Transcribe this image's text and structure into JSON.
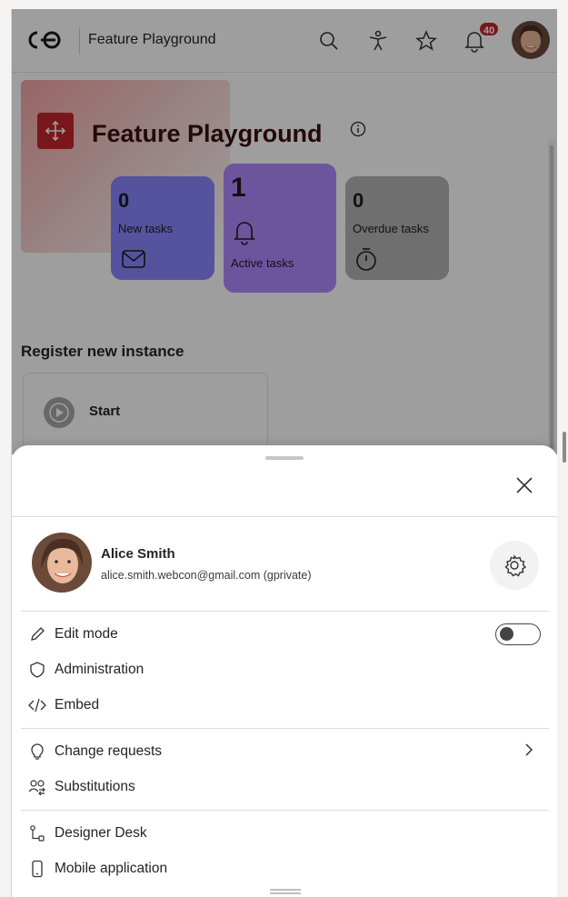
{
  "topbar": {
    "title": "Feature Playground",
    "notification_count": "40",
    "icons": [
      "logo-icon",
      "search-icon",
      "accessibility-icon",
      "star-icon",
      "bell-icon"
    ]
  },
  "dashboard": {
    "title": "Feature Playground",
    "tiles": [
      {
        "count": "0",
        "label": "New tasks",
        "icon": "mail-icon",
        "color": "#8a86ff"
      },
      {
        "count": "1",
        "label": "Active tasks",
        "icon": "bell-icon",
        "color": "#b18aff"
      },
      {
        "count": "0",
        "label": "Overdue tasks",
        "icon": "timer-icon",
        "color": "#b4b4b4"
      }
    ],
    "section_title": "Register new instance",
    "start_label": "Start"
  },
  "sheet": {
    "user": {
      "name": "Alice Smith",
      "email": "alice.smith.webcon@gmail.com (gprivate)"
    },
    "menu": {
      "edit_mode": "Edit mode",
      "administration": "Administration",
      "embed": "Embed",
      "change_requests": "Change requests",
      "substitutions": "Substitutions",
      "designer_desk": "Designer Desk",
      "mobile_application": "Mobile application"
    },
    "edit_mode_on": false
  },
  "colors": {
    "brand": "#c4262e",
    "badge": "#c4262e"
  }
}
